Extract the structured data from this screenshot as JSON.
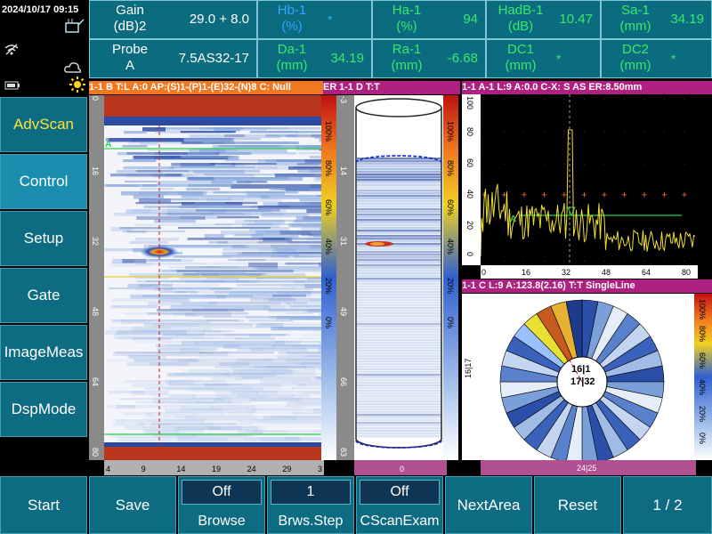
{
  "status": {
    "datetime": "2024/10/17  09:15"
  },
  "header": {
    "row1": [
      {
        "label": "Gain\n(dB)2",
        "value": "29.0 + 8.0",
        "label_color": "white",
        "value_color": "white"
      },
      {
        "label": "Hb-1\n(%)",
        "value": "*",
        "label_color": "blue",
        "value_color": "blue"
      },
      {
        "label": "Ha-1\n(%)",
        "value": "94",
        "label_color": "green",
        "value_color": "green"
      },
      {
        "label": "HadB-1\n(dB)",
        "value": "10.47",
        "label_color": "green",
        "value_color": "green"
      },
      {
        "label": "Sa-1\n(mm)",
        "value": "34.19",
        "label_color": "green",
        "value_color": "green"
      }
    ],
    "row2": [
      {
        "label": "Probe\nA",
        "value": "7.5AS32-17",
        "label_color": "white",
        "value_color": "white"
      },
      {
        "label": "Da-1\n(mm)",
        "value": "34.19",
        "label_color": "green",
        "value_color": "green"
      },
      {
        "label": "Ra-1\n(mm)",
        "value": "-6.68",
        "label_color": "green",
        "value_color": "green"
      },
      {
        "label": "DC1\n(mm)",
        "value": "*",
        "label_color": "green",
        "value_color": "green"
      },
      {
        "label": "DC2\n(mm)",
        "value": "*",
        "label_color": "green",
        "value_color": "green"
      }
    ]
  },
  "menu": [
    {
      "label": "AdvScan",
      "accent": true,
      "active": false
    },
    {
      "label": "Control",
      "accent": false,
      "active": true
    },
    {
      "label": "Setup",
      "accent": false,
      "active": false
    },
    {
      "label": "Gate",
      "accent": false,
      "active": false
    },
    {
      "label": "ImageMeas",
      "accent": false,
      "active": false
    },
    {
      "label": "DspMode",
      "accent": false,
      "active": false
    }
  ],
  "bottom": {
    "start": "Start",
    "save": "Save",
    "browse": {
      "value": "Off",
      "label": "Browse"
    },
    "brws_step": {
      "value": "1",
      "label": "Brws.Step"
    },
    "cscan_exam": {
      "value": "Off",
      "label": "CScanExam"
    },
    "next_area": "NextArea",
    "reset": "Reset",
    "page": "1 / 2"
  },
  "bscan": {
    "header": "1-1 B  T:L A:0 AP:(S)1-(P)1-(E)32-(N)8 C: Null",
    "header_tail": "ER",
    "y_ticks": [
      "0",
      "16",
      "32",
      "48",
      "64",
      "80"
    ],
    "x_ticks": [
      "4",
      "9",
      "14",
      "19",
      "24",
      "29",
      "3"
    ],
    "gate_label": "A",
    "color_scale": [
      "100%",
      "80%",
      "60%",
      "40%",
      "20%",
      "0%"
    ]
  },
  "dscan": {
    "header": "1-1 D T:T",
    "y_ticks": [
      "-3",
      "14",
      "31",
      "49",
      "66",
      "83"
    ],
    "x_ticks": [
      "0"
    ],
    "color_scale": [
      "100%",
      "80%",
      "60%",
      "40%",
      "20%",
      "0%"
    ]
  },
  "ascan": {
    "header": "1-1 A-1  L:9  A:0.0  C-X: S  AS    ER:8.50mm",
    "y_ticks": [
      "100",
      "80",
      "60",
      "40",
      "20",
      "0"
    ],
    "x_ticks": [
      "0",
      "16",
      "32",
      "48",
      "64",
      "80"
    ],
    "gate_label": "A"
  },
  "cscan": {
    "header": "1-1 C L:9 A:123.8(2.16) T:T SingleLine",
    "y_label": "16|17",
    "x_label": "24|25",
    "center_label_1": "16|1",
    "center_label_2": "17|32",
    "color_scale": [
      "100%",
      "80%",
      "60%",
      "40%",
      "20%",
      "0%"
    ]
  },
  "colors": {
    "panel_header_b": "#f07820",
    "panel_header_d": "#b02080",
    "panel_header_a": "#b02080",
    "panel_header_c": "#b02080",
    "header_cell": "#0b6c80",
    "menu_bg": "#0d6b82"
  }
}
